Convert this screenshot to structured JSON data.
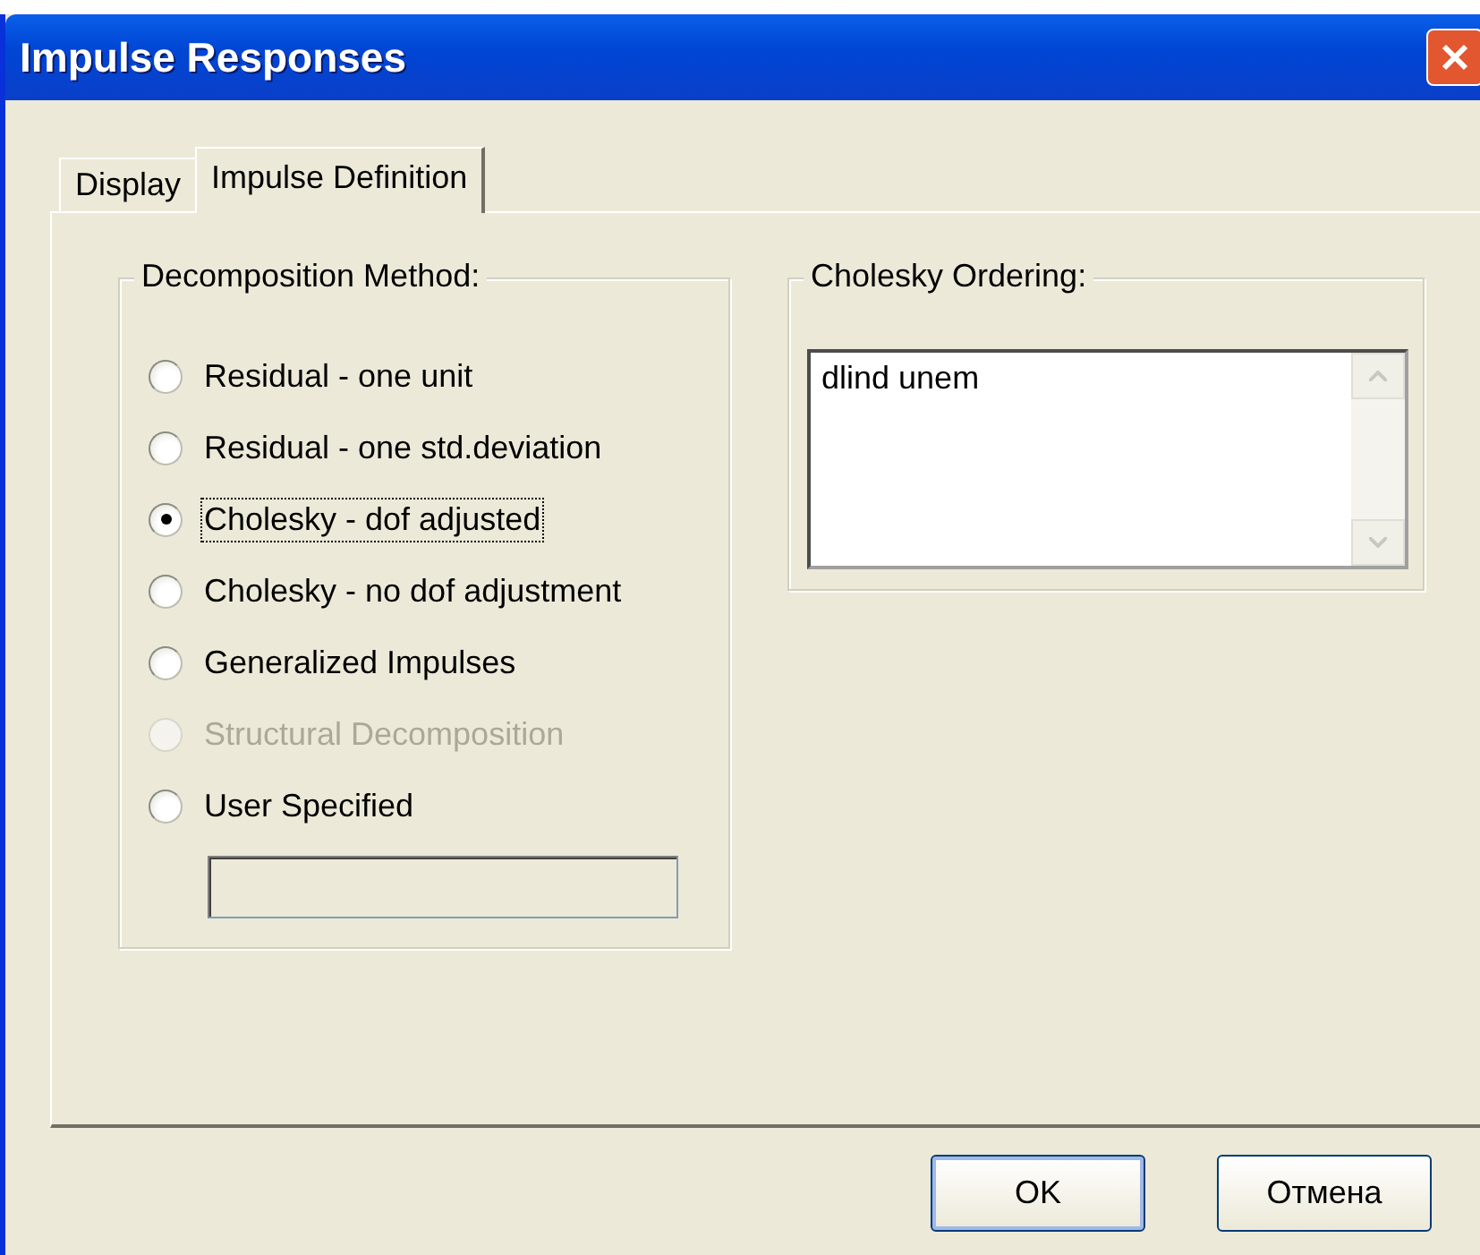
{
  "window": {
    "title": "Impulse Responses"
  },
  "tabs": [
    {
      "label": "Display",
      "selected": false
    },
    {
      "label": "Impulse Definition",
      "selected": true
    }
  ],
  "decomposition": {
    "title": "Decomposition Method:",
    "options": [
      {
        "label": "Residual - one unit",
        "selected": false,
        "disabled": false,
        "focused": false
      },
      {
        "label": "Residual - one std.deviation",
        "selected": false,
        "disabled": false,
        "focused": false
      },
      {
        "label": "Cholesky - dof adjusted",
        "selected": true,
        "disabled": false,
        "focused": true
      },
      {
        "label": "Cholesky - no dof adjustment",
        "selected": false,
        "disabled": false,
        "focused": false
      },
      {
        "label": "Generalized Impulses",
        "selected": false,
        "disabled": false,
        "focused": false
      },
      {
        "label": "Structural Decomposition",
        "selected": false,
        "disabled": true,
        "focused": false
      },
      {
        "label": "User Specified",
        "selected": false,
        "disabled": false,
        "focused": false
      }
    ]
  },
  "ordering": {
    "title": "Cholesky Ordering:",
    "value": "dlind unem"
  },
  "buttons": [
    {
      "label": "OK",
      "default": true
    },
    {
      "label": "Отмена",
      "default": false
    }
  ]
}
